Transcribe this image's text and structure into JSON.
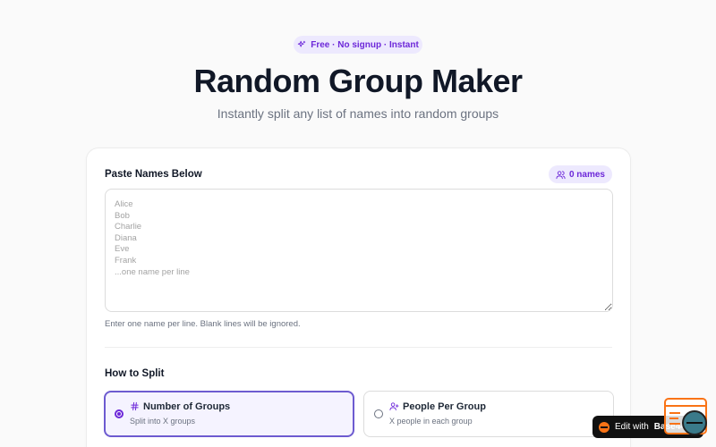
{
  "badge": {
    "text": "Free · No signup · Instant",
    "icon": "sparkles-icon"
  },
  "header": {
    "title": "Random Group Maker",
    "subtitle": "Instantly split any list of names into random groups"
  },
  "names_section": {
    "label": "Paste Names Below",
    "count_label": "0 names",
    "value": "",
    "placeholder": "Alice\nBob\nCharlie\nDiana\nEve\nFrank\n...one name per line",
    "hint": "Enter one name per line. Blank lines will be ignored."
  },
  "split_section": {
    "label": "How to Split",
    "options": [
      {
        "title": "Number of Groups",
        "description": "Split into X groups",
        "icon": "hash-icon",
        "selected": true
      },
      {
        "title": "People Per Group",
        "description": "X people in each group",
        "icon": "user-plus-icon",
        "selected": false
      }
    ]
  },
  "footer_badge": {
    "prefix": "Edit with",
    "brand": "Base44"
  },
  "colors": {
    "accent": "#6d28d9",
    "accent_light": "#ede9fe",
    "brand_orange": "#f97316"
  }
}
